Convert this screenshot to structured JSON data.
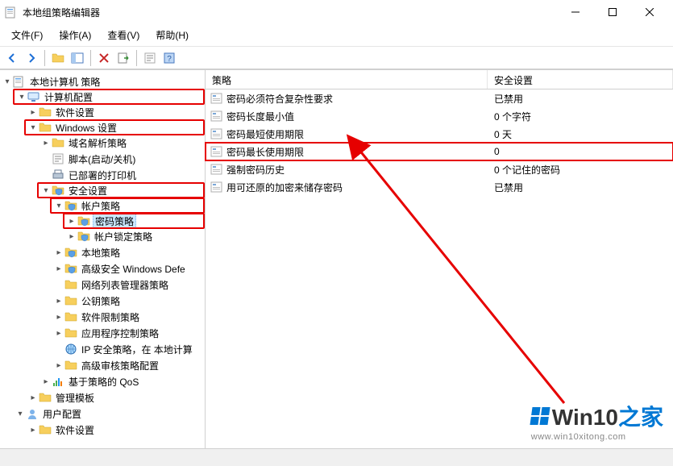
{
  "window": {
    "title": "本地组策略编辑器"
  },
  "menu": {
    "file": "文件(F)",
    "action": "操作(A)",
    "view": "查看(V)",
    "help": "帮助(H)"
  },
  "tree": {
    "root": "本地计算机 策略",
    "computer_config": "计算机配置",
    "software_settings": "软件设置",
    "windows_settings": "Windows 设置",
    "name_resolution": "域名解析策略",
    "scripts": "脚本(启动/关机)",
    "deployed_printers": "已部署的打印机",
    "security_settings": "安全设置",
    "account_policy": "帐户策略",
    "password_policy": "密码策略",
    "lockout_policy": "帐户锁定策略",
    "local_policy": "本地策略",
    "defender": "高级安全 Windows Defe",
    "network_list": "网络列表管理器策略",
    "public_key": "公钥策略",
    "software_restriction": "软件限制策略",
    "app_control": "应用程序控制策略",
    "ip_security": "IP 安全策略，在 本地计算",
    "advanced_audit": "高级审核策略配置",
    "policy_qos": "基于策略的 QoS",
    "admin_templates": "管理模板",
    "user_config": "用户配置",
    "user_software": "软件设置"
  },
  "list": {
    "headers": {
      "policy": "策略",
      "setting": "安全设置"
    },
    "rows": [
      {
        "policy": "密码必须符合复杂性要求",
        "setting": "已禁用"
      },
      {
        "policy": "密码长度最小值",
        "setting": "0 个字符"
      },
      {
        "policy": "密码最短使用期限",
        "setting": "0 天"
      },
      {
        "policy": "密码最长使用期限",
        "setting": "0"
      },
      {
        "policy": "强制密码历史",
        "setting": "0 个记住的密码"
      },
      {
        "policy": "用可还原的加密来储存密码",
        "setting": "已禁用"
      }
    ]
  },
  "watermark": {
    "brand_part1": "Win10",
    "brand_part2": "之家",
    "url": "www.win10xitong.com"
  }
}
